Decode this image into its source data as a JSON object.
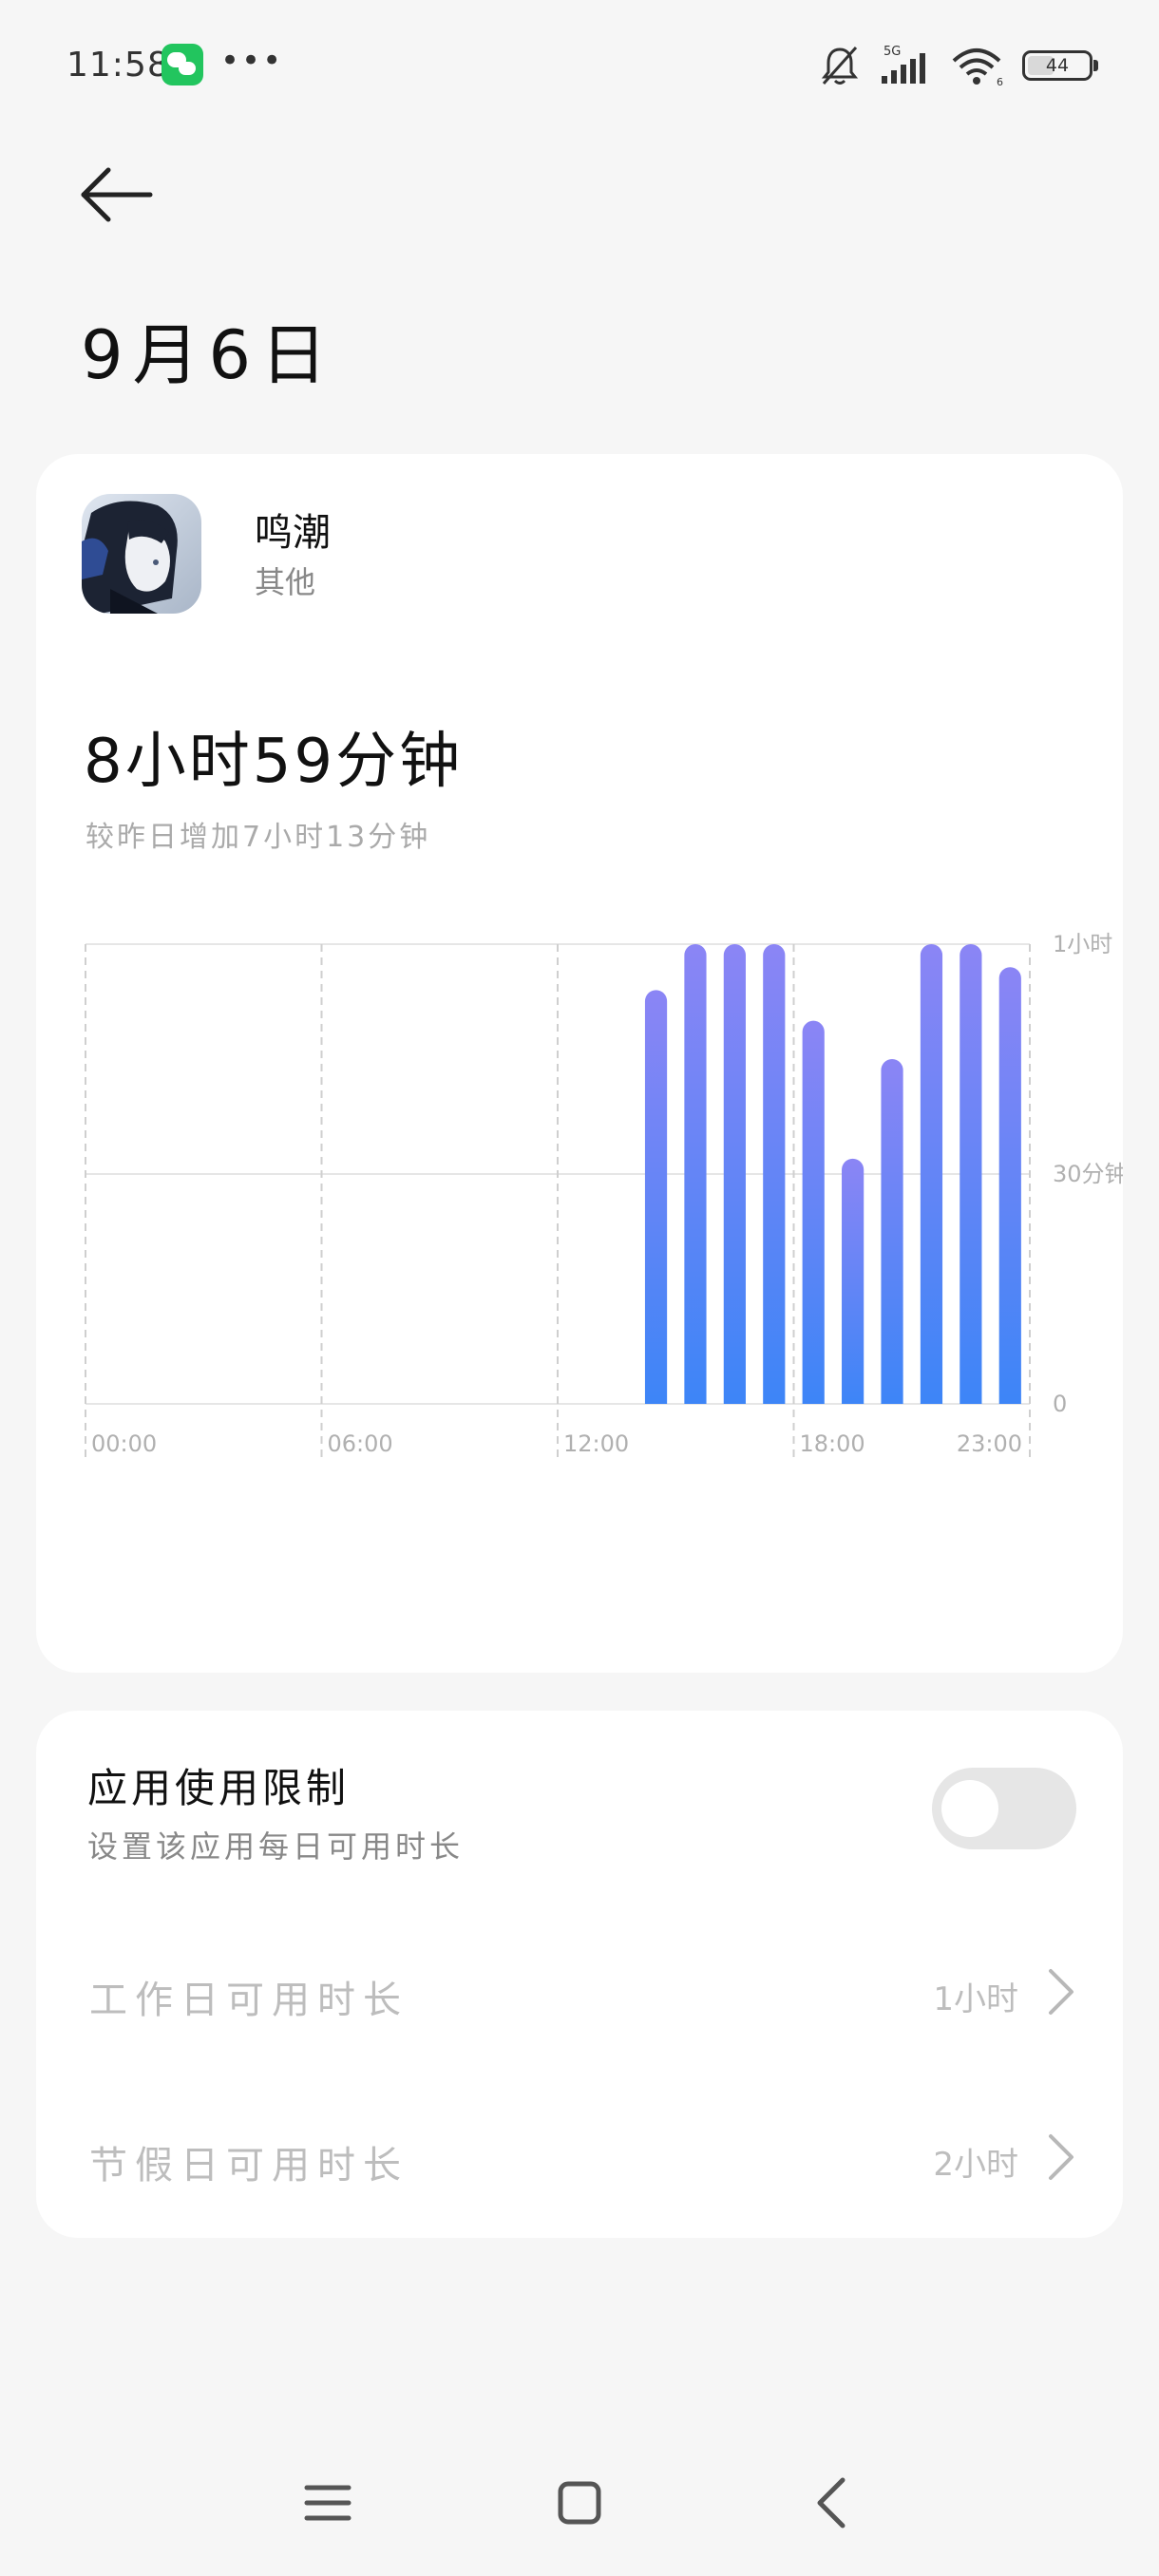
{
  "status_bar": {
    "time": "11:58",
    "network": "5G",
    "wifi_sub": "6",
    "battery": "44",
    "battery_level": 0.44,
    "icons": [
      "wechat-icon",
      "more-dots-icon",
      "bell-muted-icon",
      "signal-icon",
      "wifi-icon",
      "battery-icon"
    ]
  },
  "header": {
    "title": "9月6日"
  },
  "app": {
    "name": "鸣潮",
    "category": "其他",
    "total_time": "8小时59分钟",
    "compare_text": "较昨日增加7小时13分钟"
  },
  "chart_data": {
    "type": "bar",
    "x": [
      14,
      15,
      16,
      17,
      18,
      19,
      20,
      21,
      22,
      23
    ],
    "values": [
      54,
      60,
      60,
      60,
      50,
      32,
      45,
      60,
      60,
      57
    ],
    "x_tick_labels": [
      "00:00",
      "06:00",
      "12:00",
      "18:00",
      "23:00"
    ],
    "x_tick_values": [
      0,
      6,
      12,
      18,
      23
    ],
    "y_tick_labels": [
      "1小时",
      "30分钟",
      "0"
    ],
    "y_tick_values": [
      60,
      30,
      0
    ],
    "ylim": [
      0,
      60
    ],
    "xlim": [
      0,
      24
    ],
    "grid": true,
    "colors": {
      "bar_top": "#8b85f5",
      "bar_bottom": "#3d85f7"
    }
  },
  "limits": {
    "title": "应用使用限制",
    "subtitle": "设置该应用每日可用时长",
    "enabled": false,
    "rows": [
      {
        "label": "工作日可用时长",
        "value": "1小时"
      },
      {
        "label": "节假日可用时长",
        "value": "2小时"
      }
    ]
  },
  "nav": {
    "icons": [
      "menu-icon",
      "home-square-icon",
      "back-chevron-icon"
    ]
  },
  "colors": {
    "background": "#f6f6f6",
    "card": "#ffffff",
    "wechat_green": "#22c55e",
    "toggle_off": "#e6e6e6"
  }
}
